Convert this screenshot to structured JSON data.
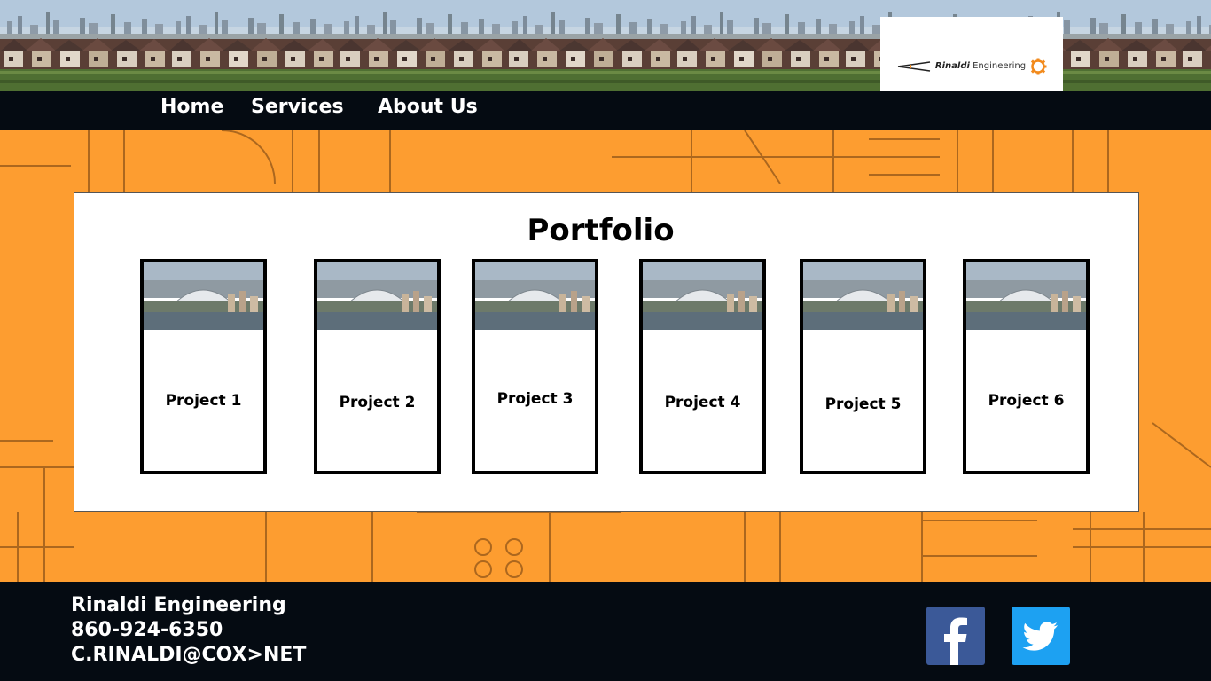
{
  "header": {
    "logo_brand": "Rinaldi",
    "logo_word": "Engineering"
  },
  "nav": {
    "items": [
      {
        "label": "Home"
      },
      {
        "label": "Services"
      },
      {
        "label": "About Us"
      }
    ]
  },
  "portfolio": {
    "title": "Portfolio",
    "projects": [
      {
        "label": "Project 1"
      },
      {
        "label": "Project 2"
      },
      {
        "label": "Project 3"
      },
      {
        "label": "Project 4"
      },
      {
        "label": "Project 5"
      },
      {
        "label": "Project 6"
      }
    ]
  },
  "footer": {
    "company": "Rinaldi Engineering",
    "phone": "860-924-6350",
    "email": "C.RINALDI@COX>NET"
  },
  "social": {
    "facebook_icon": "facebook-icon",
    "twitter_icon": "twitter-icon"
  },
  "colors": {
    "accent_orange": "#fd9d30",
    "dark_bar": "#050b12",
    "facebook_blue": "#3b5998",
    "twitter_blue": "#1da1f2"
  }
}
